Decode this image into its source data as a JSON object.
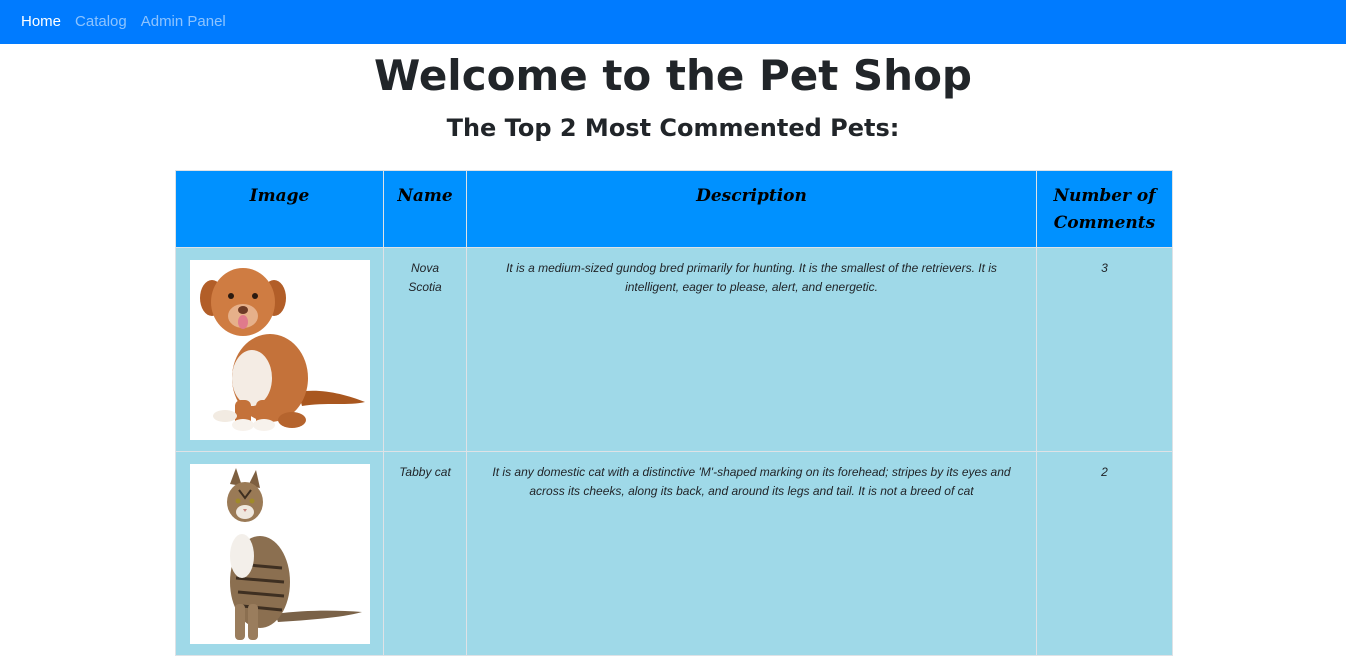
{
  "nav": {
    "items": [
      {
        "label": "Home",
        "active": true
      },
      {
        "label": "Catalog",
        "active": false
      },
      {
        "label": "Admin Panel",
        "active": false
      }
    ]
  },
  "main": {
    "title": "Welcome to the Pet Shop",
    "subtitle": "The Top 2 Most Commented Pets:"
  },
  "table": {
    "headers": [
      "Image",
      "Name",
      "Description",
      "Number of Comments"
    ],
    "rows": [
      {
        "image": "dog-photo",
        "name": "Nova Scotia",
        "description": "It is a medium-sized gundog bred primarily for hunting. It is the smallest of the retrievers. It is intelligent, eager to please, alert, and energetic.",
        "comments": "3"
      },
      {
        "image": "cat-photo",
        "name": "Tabby cat",
        "description": "It is any domestic cat with a distinctive 'M'-shaped marking on its forehead; stripes by its eyes and across its cheeks, along its back, and around its legs and tail. It is not a breed of cat",
        "comments": "2"
      }
    ]
  },
  "colors": {
    "navbar": "#007bff",
    "table_header": "#0091ff",
    "table_row": "#9fd9e8"
  }
}
